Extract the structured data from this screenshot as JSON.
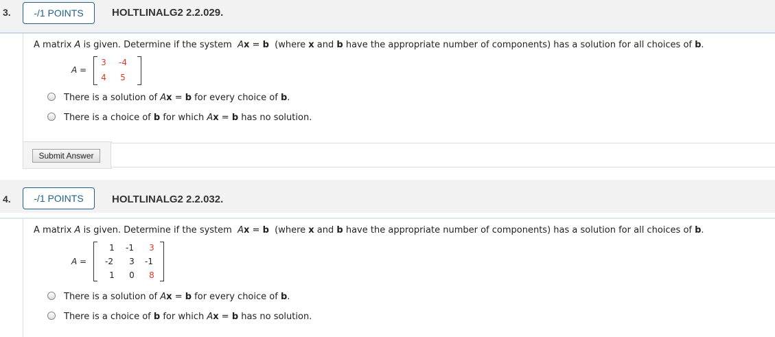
{
  "questions": [
    {
      "number": "3.",
      "points": "-/1 POINTS",
      "id": "HOLTLINALG2 2.2.029.",
      "prompt": {
        "t1": "A matrix ",
        "A": "A",
        "t2": " is given. Determine if the system ",
        "Ax_A": "A",
        "Ax_x": "x",
        "eq": " = ",
        "b": "b",
        "t3": " (where ",
        "x": "x",
        "t4": " and ",
        "b2": "b",
        "t5": " have the appropriate number of components) has a solution for all choices of ",
        "b3": "b",
        "t6": "."
      },
      "matrix_label": "A =",
      "matrix": [
        [
          "3",
          "-4"
        ],
        [
          "4",
          "5"
        ]
      ],
      "options": [
        {
          "pre": "There is a solution of ",
          "A": "A",
          "x": "x",
          "eq": " = ",
          "b": "b",
          "mid": " for every choice of ",
          "b2": "b",
          "post": "."
        },
        {
          "pre": "There is a choice of ",
          "b": "b",
          "mid": " for which ",
          "A": "A",
          "x": "x",
          "eq": " = ",
          "b2": "b",
          "post": " has no solution."
        }
      ],
      "submit_label": "Submit Answer"
    },
    {
      "number": "4.",
      "points": "-/1 POINTS",
      "id": "HOLTLINALG2 2.2.032.",
      "matrix_label": "A =",
      "matrix": [
        [
          "1",
          "-1",
          "3"
        ],
        [
          "-2",
          "3",
          "-1"
        ],
        [
          "1",
          "0",
          "8"
        ]
      ],
      "options": [
        {
          "pre": "There is a solution of ",
          "A": "A",
          "x": "x",
          "eq": " = ",
          "b": "b",
          "mid": " for every choice of ",
          "b2": "b",
          "post": "."
        },
        {
          "pre": "There is a choice of ",
          "b": "b",
          "mid": " for which ",
          "A": "A",
          "x": "x",
          "eq": " = ",
          "b2": "b",
          "post": " has no solution."
        }
      ]
    }
  ]
}
